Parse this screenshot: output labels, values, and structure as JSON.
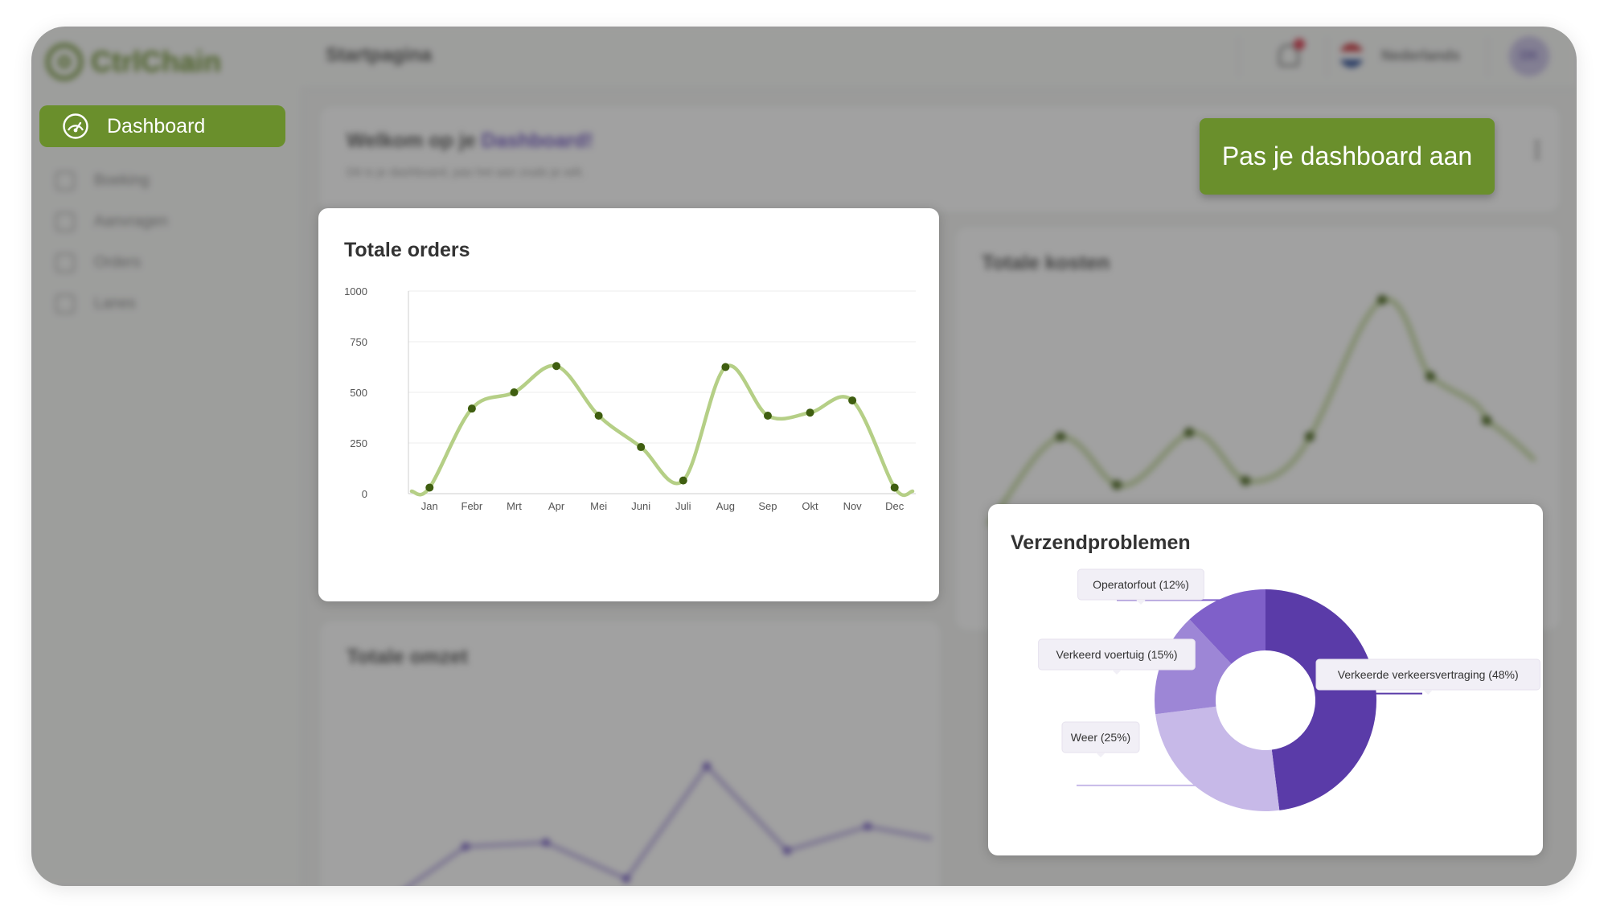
{
  "app": {
    "logo_text": "CtrlChain",
    "page_title": "Startpagina",
    "language": "Nederlands",
    "avatar_initials": "DK"
  },
  "sidebar": {
    "items": [
      {
        "label": "Dashboard",
        "active": true,
        "icon": "speedometer-icon"
      },
      {
        "label": "Boeking",
        "active": false,
        "icon": "box-icon"
      },
      {
        "label": "Aanvragen",
        "active": false,
        "icon": "inbox-icon"
      },
      {
        "label": "Orders",
        "active": false,
        "icon": "clipboard-icon"
      },
      {
        "label": "Lanes",
        "active": false,
        "icon": "route-icon"
      }
    ]
  },
  "welcome": {
    "title_prefix": "Welkom op je ",
    "title_highlight": "Dashboard!",
    "subtitle": "Dit is je dashboard, pas het aan zoals je wilt."
  },
  "customize_button": "Pas je dashboard aan",
  "background_cards": {
    "costs_title": "Totale kosten",
    "revenue_title": "Totale omzet"
  },
  "colors": {
    "brand_green": "#6a8f2c",
    "line_green": "#b5cf86",
    "marker_green": "#3f5e10",
    "purple_dark": "#5a3ba8",
    "purple_mid": "#7f60c9",
    "purple_light": "#9d86d6",
    "purple_pale": "#c7b9e8"
  },
  "chart_data": [
    {
      "id": "orders",
      "type": "line",
      "title": "Totale orders",
      "categories": [
        "Jan",
        "Febr",
        "Mrt",
        "Apr",
        "Mei",
        "Juni",
        "Juli",
        "Aug",
        "Sep",
        "Okt",
        "Nov",
        "Dec"
      ],
      "values": [
        30,
        420,
        500,
        630,
        385,
        230,
        65,
        625,
        385,
        400,
        460,
        30
      ],
      "ylim": [
        0,
        1000
      ],
      "yticks": [
        0,
        250,
        500,
        750,
        1000
      ],
      "xlabel": "",
      "ylabel": "",
      "grid": true
    },
    {
      "id": "shipping-problems",
      "type": "pie",
      "title": "Verzendproblemen",
      "slices": [
        {
          "label": "Verkeerde verkeersvertraging (48%)",
          "value": 48,
          "color": "#5a3ba8"
        },
        {
          "label": "Weer (25%)",
          "value": 25,
          "color": "#c7b9e8"
        },
        {
          "label": "Verkeerd voertuig (15%)",
          "value": 15,
          "color": "#9d86d6"
        },
        {
          "label": "Operatorfout (12%)",
          "value": 12,
          "color": "#7f60c9"
        }
      ]
    }
  ]
}
